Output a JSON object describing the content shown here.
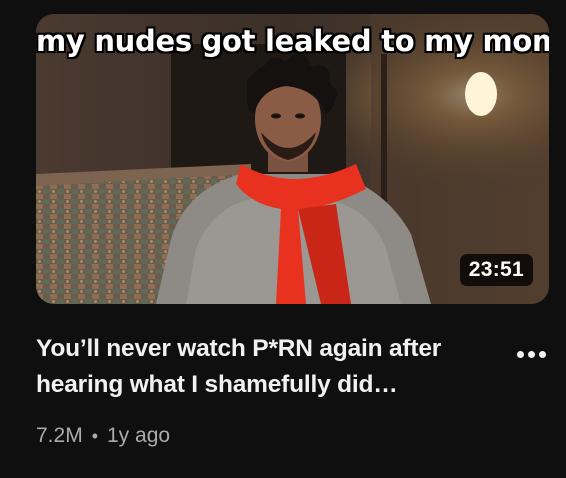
{
  "video": {
    "thumbnail_overlay_text": "my nudes got leaked to my mom",
    "duration": "23:51",
    "title": "You’ll never watch P*RN again after hearing what I shamefully did…",
    "views": "7.2M",
    "separator": "•",
    "age": "1y ago",
    "menu_icon": "more-vert-icon"
  },
  "colors": {
    "background": "#0f0f0f",
    "title": "#f1f1f1",
    "meta": "#aaaaaa",
    "scarf": "#e8321f"
  }
}
